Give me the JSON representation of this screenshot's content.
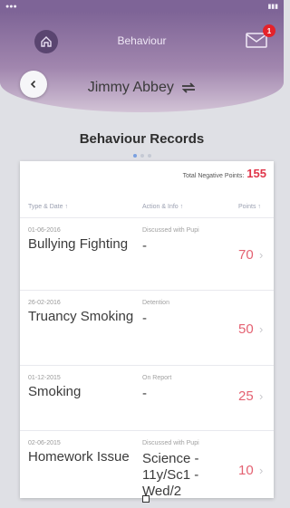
{
  "header": {
    "title": "Behaviour",
    "notification_count": "1"
  },
  "student": {
    "name": "Jimmy Abbey"
  },
  "section": {
    "title": "Behaviour Records"
  },
  "summary": {
    "label": "Total Negative Points:",
    "value": "155"
  },
  "table": {
    "columns": [
      "Type & Date ↑",
      "Action & Info ↑",
      "Points ↑"
    ],
    "rows": [
      {
        "date": "01-06-2016",
        "type": "Bullying Fighting",
        "action": "Discussed with Pupi",
        "info": "-",
        "points": "70"
      },
      {
        "date": "26-02-2016",
        "type": "Truancy Smoking",
        "action": "Detention",
        "info": "-",
        "points": "50"
      },
      {
        "date": "01-12-2015",
        "type": "Smoking",
        "action": "On Report",
        "info": "-",
        "points": "25"
      },
      {
        "date": "02-06-2015",
        "type": "Homework Issue",
        "action": "Discussed with Pupi",
        "info": "Science - 11y/Sc1 - Wed/2",
        "points": "10"
      }
    ]
  },
  "colors": {
    "header_purple": "#7f6597",
    "points_red": "#e0364a",
    "badge_red": "#e4222a"
  },
  "icons": [
    "home-icon",
    "mail-icon",
    "back-chevron-icon",
    "swap-icon",
    "chevron-right-icon"
  ]
}
